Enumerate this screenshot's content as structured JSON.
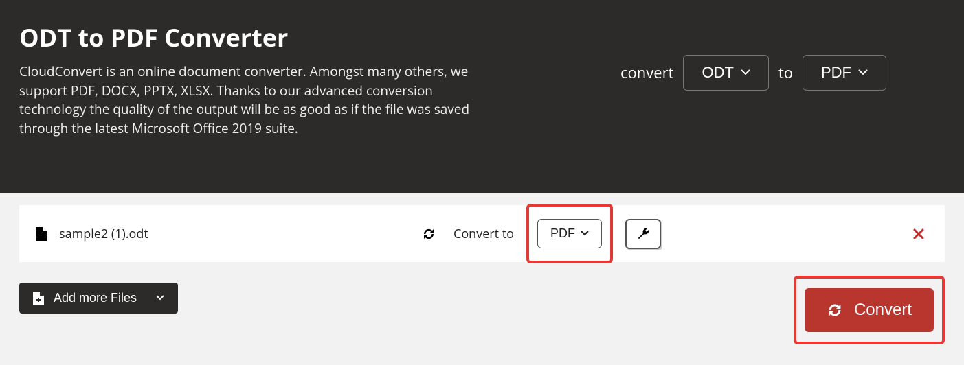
{
  "hero": {
    "title": "ODT to PDF Converter",
    "description": "CloudConvert is an online document converter. Amongst many others, we support PDF, DOCX, PPTX, XLSX. Thanks to our advanced conversion technology the quality of the output will be as good as if the file was saved through the latest Microsoft Office 2019 suite."
  },
  "convert_bar": {
    "convert_label": "convert",
    "from_format": "ODT",
    "to_label": "to",
    "to_format": "PDF"
  },
  "file": {
    "name": "sample2 (1).odt",
    "convert_to_label": "Convert to",
    "target_format": "PDF"
  },
  "actions": {
    "add_more": "Add more Files",
    "convert": "Convert"
  }
}
